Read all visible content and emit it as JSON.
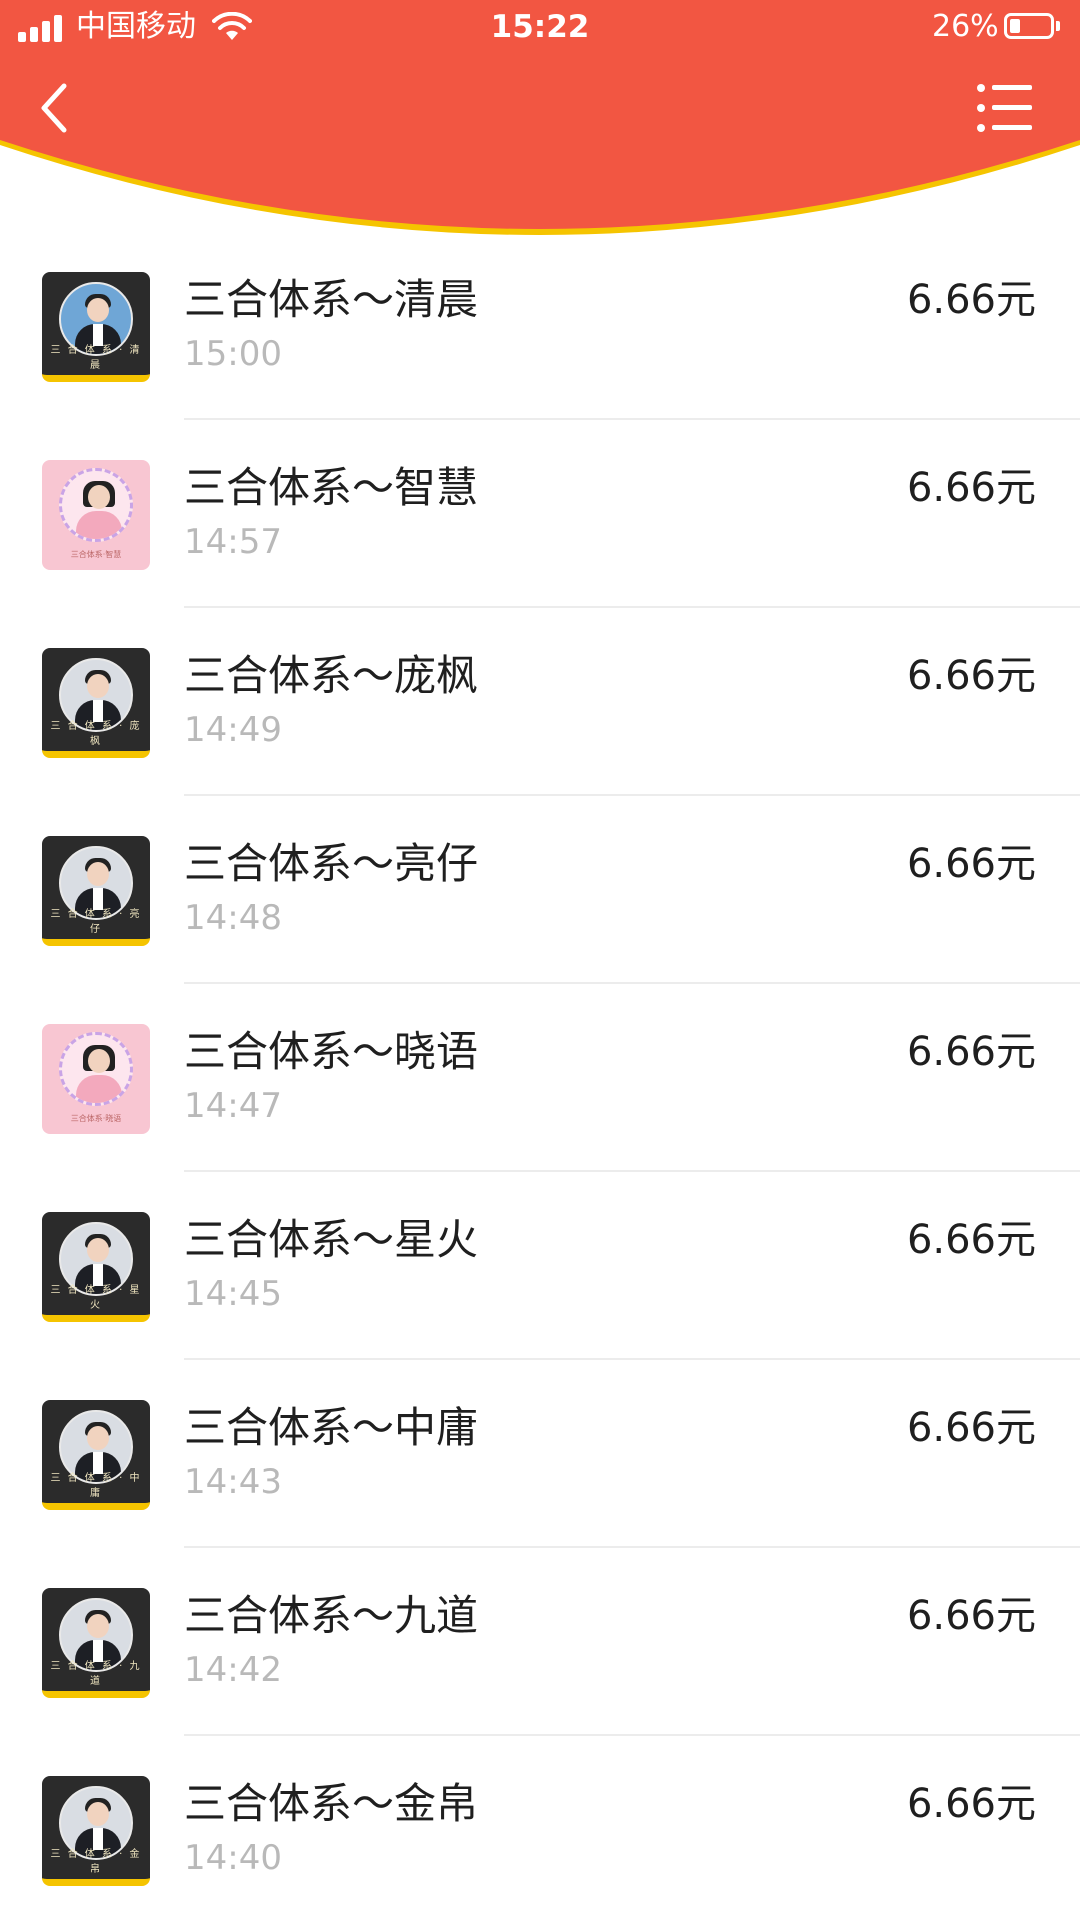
{
  "status_bar": {
    "carrier": "中国移动",
    "time": "15:22",
    "battery_percent": "26%",
    "battery_level": 0.26
  },
  "header": {
    "back_icon": "chevron-left-icon",
    "menu_icon": "list-menu-icon",
    "background_color": "#f25642",
    "curve_edge_color": "#f5c400"
  },
  "records": [
    {
      "title": "三合体系～清晨",
      "time": "15:00",
      "amount": "6.66元",
      "avatar_style": "dark",
      "avatar_caption": "三 合 体 系 · 清 晨"
    },
    {
      "title": "三合体系～智慧",
      "time": "14:57",
      "amount": "6.66元",
      "avatar_style": "pink",
      "avatar_caption": "三合体系·智慧"
    },
    {
      "title": "三合体系～庞枫",
      "time": "14:49",
      "amount": "6.66元",
      "avatar_style": "dark",
      "avatar_caption": "三 合 体 系 · 庞 枫"
    },
    {
      "title": "三合体系～亮仔",
      "time": "14:48",
      "amount": "6.66元",
      "avatar_style": "dark",
      "avatar_caption": "三 合 体 系 · 亮 仔"
    },
    {
      "title": "三合体系～晓语",
      "time": "14:47",
      "amount": "6.66元",
      "avatar_style": "pink",
      "avatar_caption": "三合体系·晓语"
    },
    {
      "title": "三合体系～星火",
      "time": "14:45",
      "amount": "6.66元",
      "avatar_style": "dark",
      "avatar_caption": "三 合 体 系 · 星 火"
    },
    {
      "title": "三合体系～中庸",
      "time": "14:43",
      "amount": "6.66元",
      "avatar_style": "dark",
      "avatar_caption": "三 合 体 系 · 中 庸"
    },
    {
      "title": "三合体系～九道",
      "time": "14:42",
      "amount": "6.66元",
      "avatar_style": "dark",
      "avatar_caption": "三 合 体 系 · 九 道"
    },
    {
      "title": "三合体系～金帛",
      "time": "14:40",
      "amount": "6.66元",
      "avatar_style": "dark",
      "avatar_caption": "三 合 体 系 · 金 帛"
    }
  ]
}
